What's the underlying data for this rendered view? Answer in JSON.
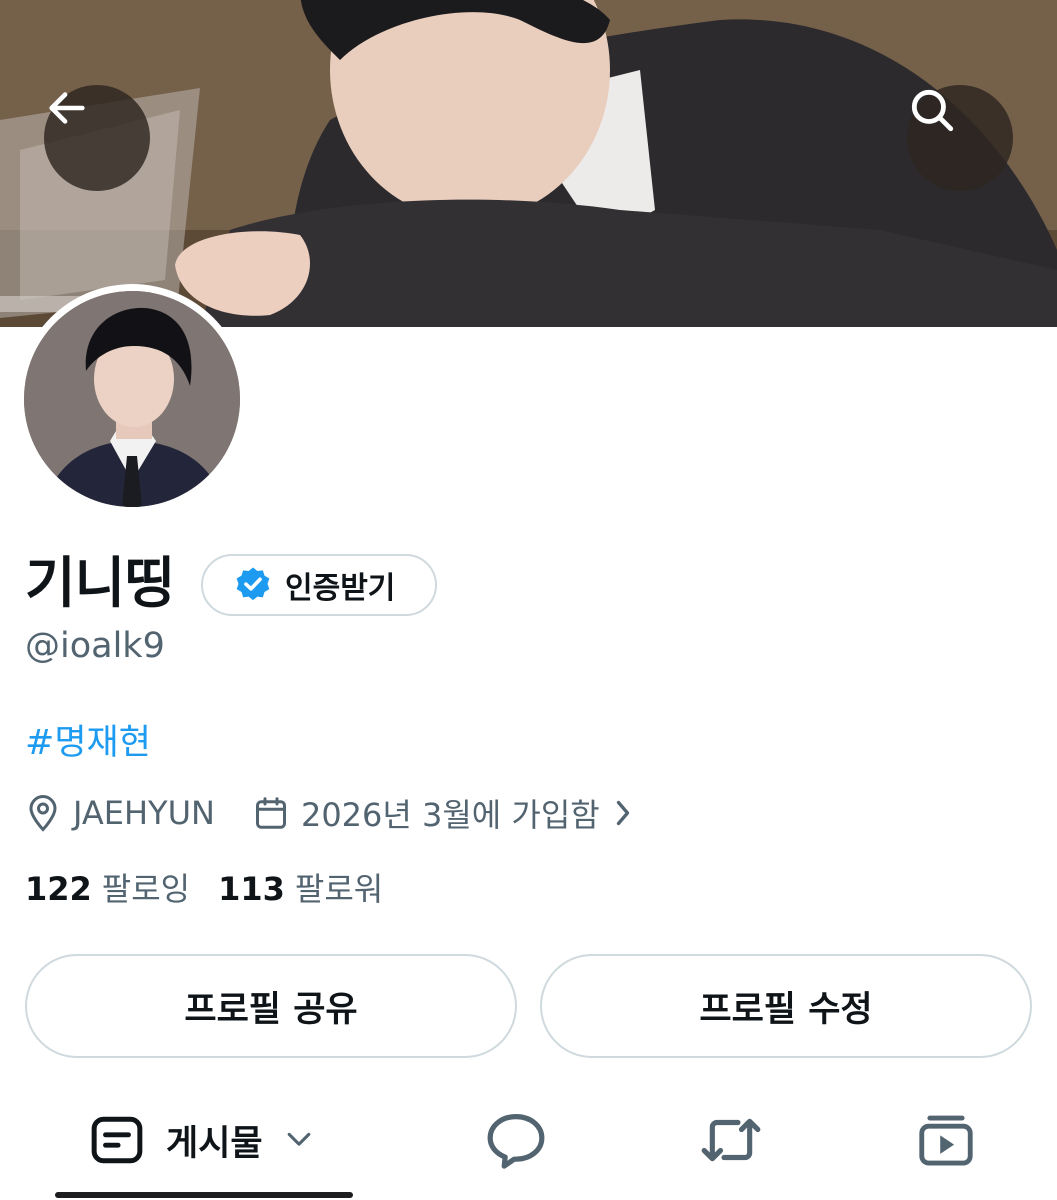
{
  "header": {
    "back_icon": "arrow-left-icon",
    "search_icon": "search-icon"
  },
  "profile": {
    "display_name": "기니띵",
    "verify_label": "인증받기",
    "verify_icon": "verified-badge-icon",
    "handle": "@ioalk9",
    "bio_hashtag": "#명재현",
    "location": "JAEHYUN",
    "location_icon": "location-pin-icon",
    "joined": "2026년 3월에 가입함",
    "joined_icon": "calendar-icon",
    "following_count": "122",
    "following_label": "팔로잉",
    "followers_count": "113",
    "followers_label": "팔로워"
  },
  "actions": {
    "share_label": "프로필 공유",
    "edit_label": "프로필 수정"
  },
  "tabs": [
    {
      "label": "게시물",
      "icon": "posts-icon",
      "selected": true
    },
    {
      "label": "",
      "icon": "reply-bubble-icon",
      "selected": false
    },
    {
      "label": "",
      "icon": "repost-icon",
      "selected": false
    },
    {
      "label": "",
      "icon": "media-play-icon",
      "selected": false
    }
  ],
  "colors": {
    "link": "#1d9bf0",
    "verified": "#1d9bf0",
    "secondary_text": "#536471",
    "border": "#cfd9de"
  }
}
